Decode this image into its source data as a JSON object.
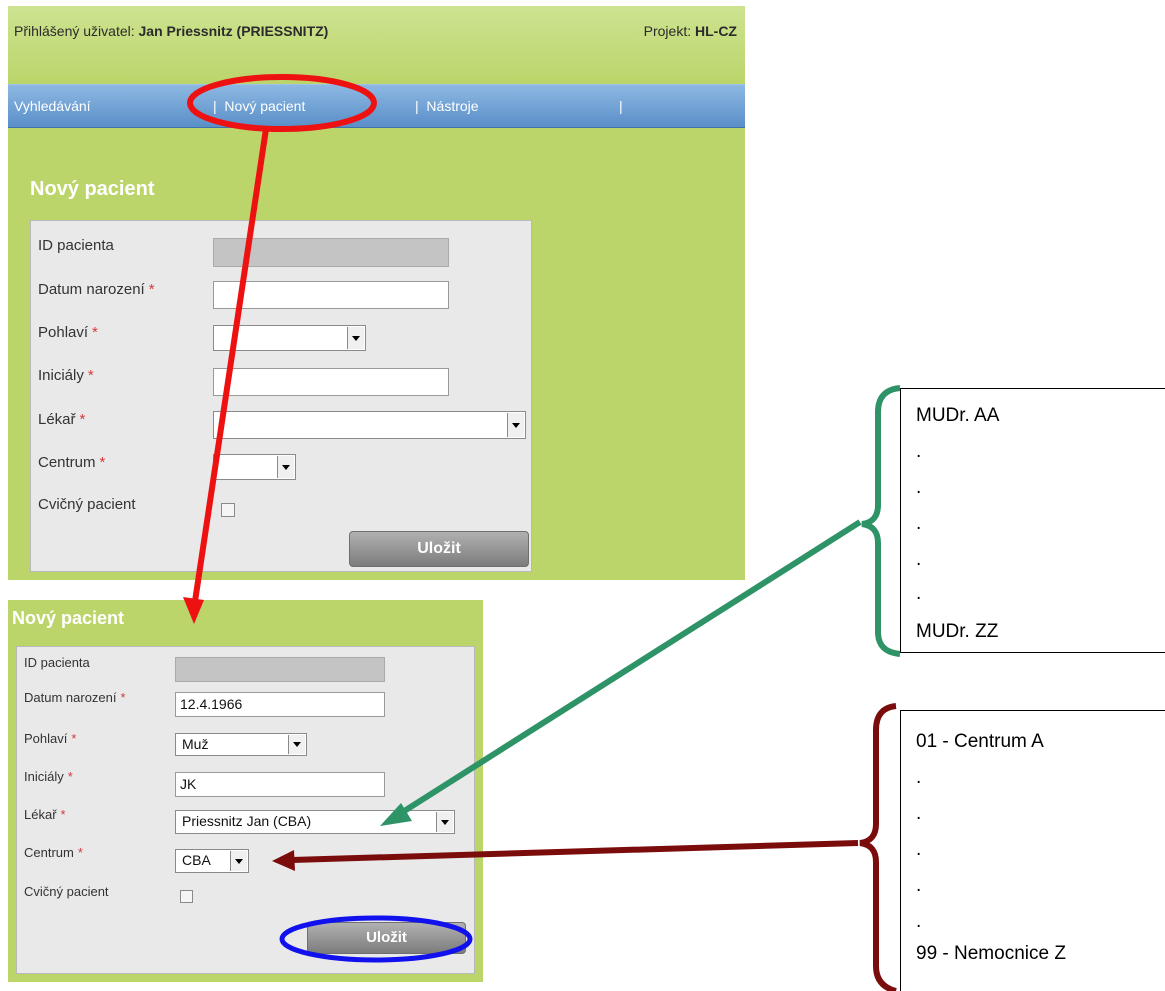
{
  "top": {
    "header": {
      "user_label": "Přihlášený uživatel:",
      "user_name": "Jan Priessnitz (PRIESSNITZ)",
      "project_label": "Projekt:",
      "project_name": "HL-CZ"
    },
    "nav": {
      "search": "Vyhledávání",
      "new_patient": "|  Nový pacient",
      "tools": "|  Nástroje",
      "sep": "|"
    },
    "title": "Nový pacient",
    "labels": {
      "id": "ID pacienta",
      "dob": "Datum narození",
      "sex": "Pohlaví",
      "initials": "Iniciály",
      "doctor": "Lékař",
      "center": "Centrum",
      "practice": "Cvičný pacient",
      "required_mark": "*"
    },
    "save": "Uložit"
  },
  "bottom": {
    "title": "Nový pacient",
    "labels": {
      "id": "ID pacienta",
      "dob": "Datum narození",
      "sex": "Pohlaví",
      "initials": "Iniciály",
      "doctor": "Lékař",
      "center": "Centrum",
      "practice": "Cvičný pacient",
      "required_mark": "*"
    },
    "values": {
      "dob": "12.4.1966",
      "sex": "Muž",
      "initials": "JK",
      "doctor": "Priessnitz Jan (CBA)",
      "center": "CBA"
    },
    "save": "Uložit"
  },
  "doctor_list": [
    "MUDr. AA",
    ".",
    ".",
    ".",
    ".",
    ".",
    "MUDr. ZZ"
  ],
  "center_list": [
    "01 - Centrum A",
    ".",
    ".",
    ".",
    ".",
    ".",
    "99 - Nemocnice Z"
  ],
  "annotation_colors": {
    "red": "#ee1111",
    "blue": "#1111ee",
    "green": "#2e9468",
    "darkred": "#7a0c0c"
  }
}
